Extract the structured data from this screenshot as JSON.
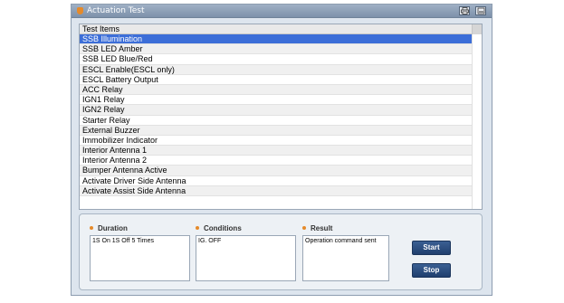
{
  "window": {
    "title": "Actuation Test"
  },
  "list": {
    "header": "Test Items",
    "selected_index": 0,
    "items": [
      "SSB Illumination",
      "SSB LED Amber",
      "SSB LED Blue/Red",
      "ESCL Enable(ESCL only)",
      "ESCL Battery Output",
      "ACC Relay",
      "IGN1 Relay",
      "IGN2 Relay",
      "Starter Relay",
      "External Buzzer",
      "Immobilizer Indicator",
      "Interior Antenna 1",
      "Interior Antenna 2",
      "Bumper Antenna Active",
      "Activate Driver Side Antenna",
      "Activate Assist Side Antenna"
    ]
  },
  "controls": {
    "duration_label": "Duration",
    "duration_value": "1S On 1S Off 5 Times",
    "conditions_label": "Conditions",
    "conditions_value": "IG. OFF",
    "result_label": "Result",
    "result_value": "Operation command sent",
    "start_label": "Start",
    "stop_label": "Stop"
  },
  "colors": {
    "selection": "#3c6ed8",
    "accent_bullet": "#e58a2a",
    "button": "#2a4b7d"
  },
  "icons": {
    "print": "print-icon",
    "minimize": "minimize-icon"
  }
}
